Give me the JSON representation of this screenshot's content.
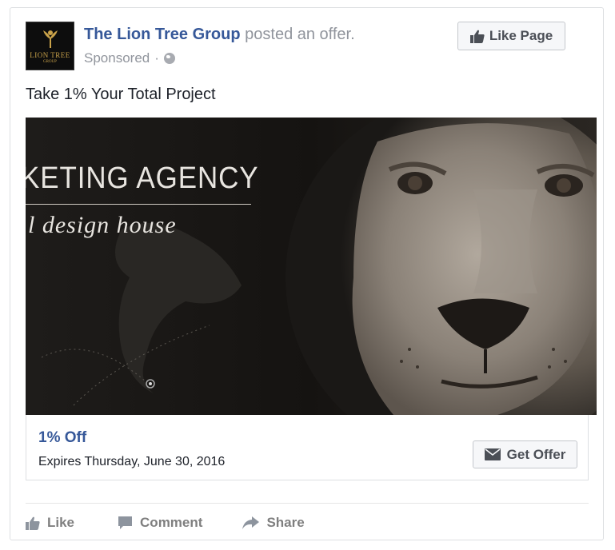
{
  "post": {
    "page_name": "The Lion Tree Group",
    "action_text": "posted an offer.",
    "sponsored": "Sponsored",
    "separator": "·",
    "body_text": "Take 1% Your Total Project",
    "logo_text": "LION TREE",
    "logo_subtext": "GROUP"
  },
  "like_page": {
    "label": "Like Page",
    "icon": "thumbs-up-icon"
  },
  "hero_image": {
    "headline": "KETING AGENCY",
    "subline": "l design house",
    "description_icon": "lion-photo"
  },
  "offer": {
    "title": "1% Off",
    "expires": "Expires Thursday, June 30, 2016",
    "button_label": "Get Offer",
    "button_icon": "envelope-icon"
  },
  "actions": [
    {
      "label": "Like",
      "icon": "thumbs-up-icon"
    },
    {
      "label": "Comment",
      "icon": "comment-icon"
    },
    {
      "label": "Share",
      "icon": "share-arrow-icon"
    }
  ],
  "colors": {
    "link": "#365899",
    "muted": "#90949c",
    "button_bg": "#f6f7f9",
    "border": "#dddfe2"
  }
}
